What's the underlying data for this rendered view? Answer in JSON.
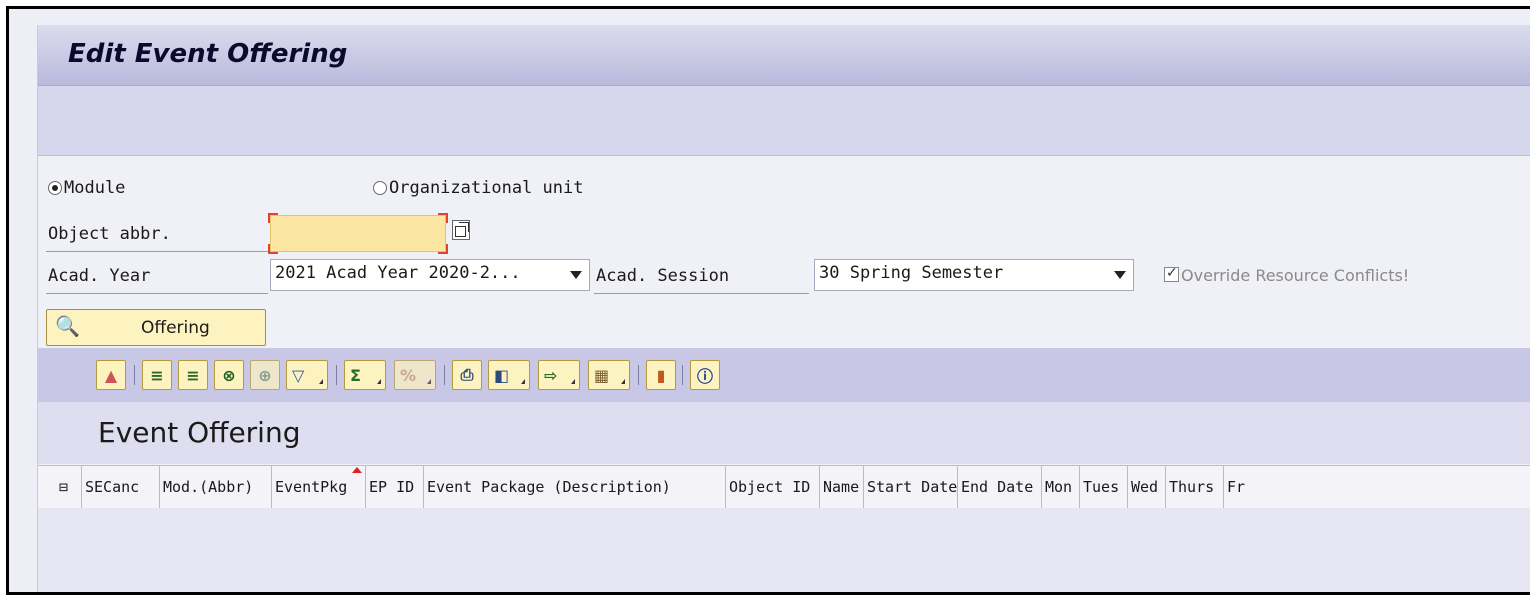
{
  "window": {
    "title": "Edit Event Offering"
  },
  "selection": {
    "radio_module": "Module",
    "radio_org": "Organizational unit",
    "object_abbr_label": "Object abbr.",
    "object_abbr_value": "",
    "acad_year_label": "Acad. Year",
    "acad_year_value": "2021 Acad Year 2020-2...",
    "acad_session_label": "Acad. Session",
    "acad_session_value": "30 Spring Semester",
    "override_label": "Override Resource Conflicts!",
    "override_checked": true,
    "selected_radio": "Module"
  },
  "offering_button": {
    "label": "Offering",
    "icon": "binoculars-icon"
  },
  "toolbar": {
    "buttons": [
      {
        "icon": "details-icon"
      },
      {
        "icon": "sort-ascending-icon"
      },
      {
        "icon": "sort-descending-icon"
      },
      {
        "icon": "find-icon"
      },
      {
        "icon": "find-next-icon"
      },
      {
        "icon": "filter-icon"
      },
      {
        "icon": "sum-icon"
      },
      {
        "icon": "subtotal-icon"
      },
      {
        "icon": "print-icon"
      },
      {
        "icon": "views-icon"
      },
      {
        "icon": "export-icon"
      },
      {
        "icon": "layout-icon"
      },
      {
        "icon": "graphic-icon"
      },
      {
        "icon": "info-icon"
      }
    ]
  },
  "grid": {
    "title": "Event Offering",
    "columns": [
      "SECanc",
      "Mod.(Abbr)",
      "EventPkg",
      "EP ID",
      "Event Package (Description)",
      "Object ID",
      "Name",
      "Start Date",
      "End Date",
      "Mon",
      "Tues",
      "Wed",
      "Thurs",
      "Fr"
    ]
  }
}
